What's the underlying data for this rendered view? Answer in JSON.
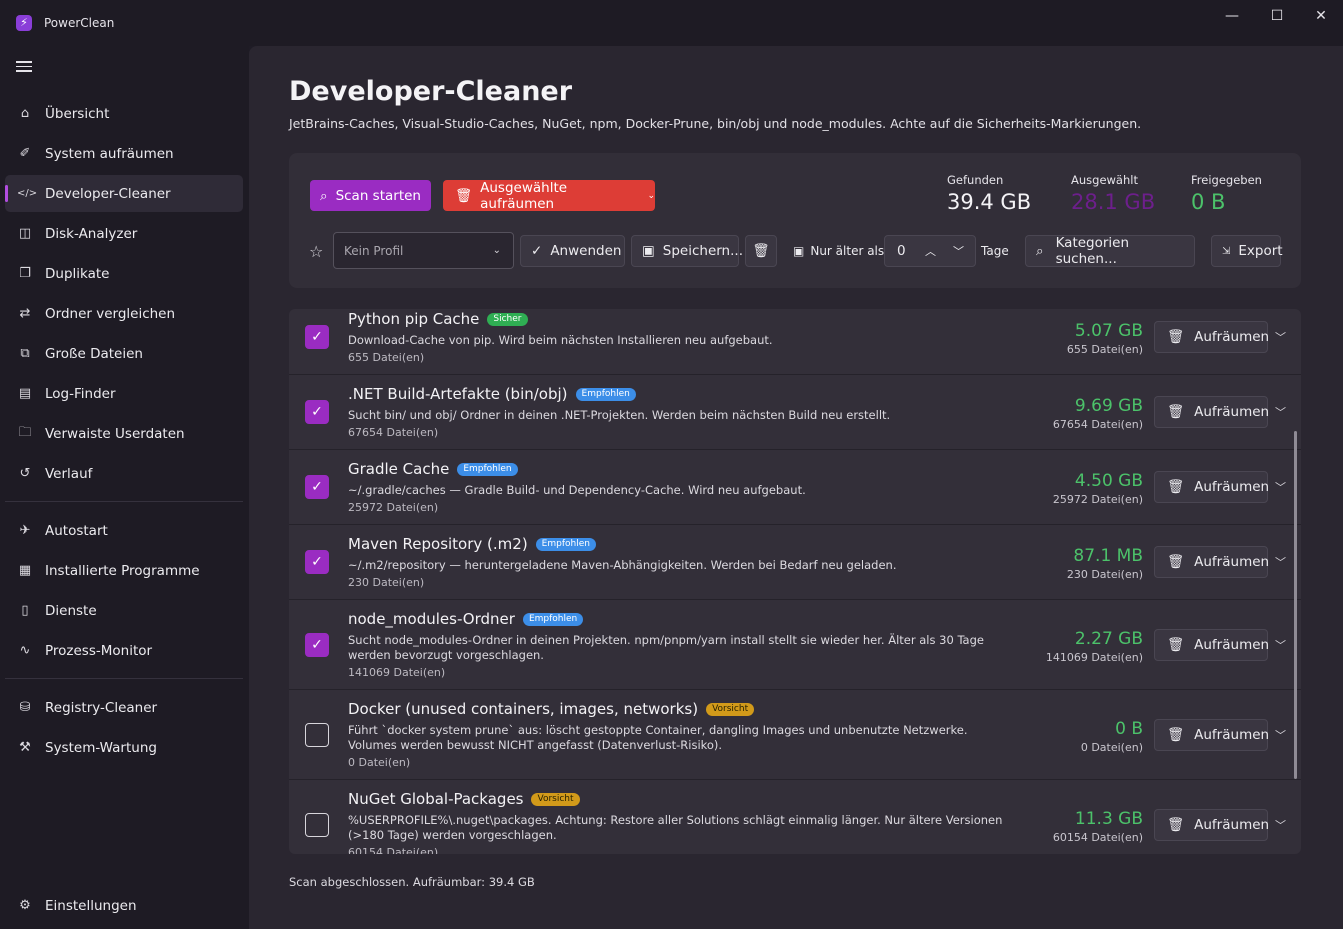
{
  "window": {
    "title": "PowerClean",
    "minimize": "—",
    "maximize": "☐",
    "close": "✕"
  },
  "sidebar": {
    "items": [
      {
        "label": "Übersicht",
        "icon": "⌂"
      },
      {
        "label": "System aufräumen",
        "icon": "✐"
      },
      {
        "label": "Developer-Cleaner",
        "icon": "</>"
      },
      {
        "label": "Disk-Analyzer",
        "icon": "◫"
      },
      {
        "label": "Duplikate",
        "icon": "❐"
      },
      {
        "label": "Ordner vergleichen",
        "icon": "⇄"
      },
      {
        "label": "Große Dateien",
        "icon": "⧉"
      },
      {
        "label": "Log-Finder",
        "icon": "▤"
      },
      {
        "label": "Verwaiste Userdaten",
        "icon": "🗀"
      },
      {
        "label": "Verlauf",
        "icon": "↺"
      },
      {
        "label": "Autostart",
        "icon": "✈"
      },
      {
        "label": "Installierte Programme",
        "icon": "▦"
      },
      {
        "label": "Dienste",
        "icon": "▯"
      },
      {
        "label": "Prozess-Monitor",
        "icon": "∿"
      },
      {
        "label": "Registry-Cleaner",
        "icon": "⛁"
      },
      {
        "label": "System-Wartung",
        "icon": "⚒"
      },
      {
        "label": "Einstellungen",
        "icon": "⚙"
      }
    ]
  },
  "page": {
    "title": "Developer-Cleaner",
    "subtitle": "JetBrains-Caches, Visual-Studio-Caches, NuGet, npm, Docker-Prune, bin/obj und node_modules. Achte auf die Sicherheits-Markierungen."
  },
  "toolbar": {
    "scan_label": "Scan starten",
    "clean_label": "Ausgewählte aufräumen",
    "profile_placeholder": "Kein Profil",
    "apply_label": "Anwenden",
    "save_label": "Speichern...",
    "older_label": "Nur älter als",
    "days_value": "0",
    "days_label": "Tage",
    "search_placeholder": "Kategorien suchen...",
    "export_label": "Export"
  },
  "stats": {
    "found_label": "Gefunden",
    "found_value": "39.4 GB",
    "selected_label": "Ausgewählt",
    "selected_value": "28.1 GB",
    "freed_label": "Freigegeben",
    "freed_value": "0 B"
  },
  "items": [
    {
      "title": "Python pip Cache",
      "badge": "Sicher",
      "badge_type": "safe",
      "checked": true,
      "desc": "Download-Cache von pip. Wird beim nächsten Installieren neu aufgebaut.",
      "files": "655 Datei(en)",
      "size": "5.07 GB",
      "count": "655  Datei(en)",
      "action": "Aufräumen"
    },
    {
      "title": ".NET Build-Artefakte (bin/obj)",
      "badge": "Empfohlen",
      "badge_type": "rec",
      "checked": true,
      "desc": "Sucht bin/ und obj/ Ordner in deinen .NET-Projekten. Werden beim nächsten Build neu erstellt.",
      "files": "67654 Datei(en)",
      "size": "9.69 GB",
      "count": "67654  Datei(en)",
      "action": "Aufräumen"
    },
    {
      "title": "Gradle Cache",
      "badge": "Empfohlen",
      "badge_type": "rec",
      "checked": true,
      "desc": "~/.gradle/caches — Gradle Build- und Dependency-Cache. Wird neu aufgebaut.",
      "files": "25972 Datei(en)",
      "size": "4.50 GB",
      "count": "25972  Datei(en)",
      "action": "Aufräumen"
    },
    {
      "title": "Maven Repository (.m2)",
      "badge": "Empfohlen",
      "badge_type": "rec",
      "checked": true,
      "desc": "~/.m2/repository — heruntergeladene Maven-Abhängigkeiten. Werden bei Bedarf neu geladen.",
      "files": "230 Datei(en)",
      "size": "87.1 MB",
      "count": "230  Datei(en)",
      "action": "Aufräumen"
    },
    {
      "title": "node_modules-Ordner",
      "badge": "Empfohlen",
      "badge_type": "rec",
      "checked": true,
      "desc": "Sucht node_modules-Ordner in deinen Projekten. npm/pnpm/yarn install stellt sie wieder her. Älter als 30 Tage werden bevorzugt vorgeschlagen.",
      "files": "141069 Datei(en)",
      "size": "2.27 GB",
      "count": "141069  Datei(en)",
      "action": "Aufräumen"
    },
    {
      "title": "Docker (unused containers, images, networks)",
      "badge": "Vorsicht",
      "badge_type": "warn",
      "checked": false,
      "desc": "Führt `docker system prune` aus: löscht gestoppte Container, dangling Images und unbenutzte Netzwerke. Volumes werden bewusst NICHT angefasst (Datenverlust-Risiko).",
      "files": "0 Datei(en)",
      "size": "0 B",
      "count": "0  Datei(en)",
      "action": "Aufräumen"
    },
    {
      "title": "NuGet Global-Packages",
      "badge": "Vorsicht",
      "badge_type": "warn",
      "checked": false,
      "desc": "%USERPROFILE%\\.nuget\\packages. Achtung: Restore aller Solutions schlägt einmalig länger. Nur ältere Versionen (>180 Tage) werden vorgeschlagen.",
      "files": "60154 Datei(en)",
      "size": "11.3 GB",
      "count": "60154  Datei(en)",
      "action": "Aufräumen"
    }
  ],
  "status": "Scan abgeschlossen. Aufräumbar: 39.4 GB",
  "colors": {
    "accent": "#9a2cc2",
    "danger": "#dd3d36",
    "success": "#4cc26a",
    "selected": "#6d1f8c"
  }
}
